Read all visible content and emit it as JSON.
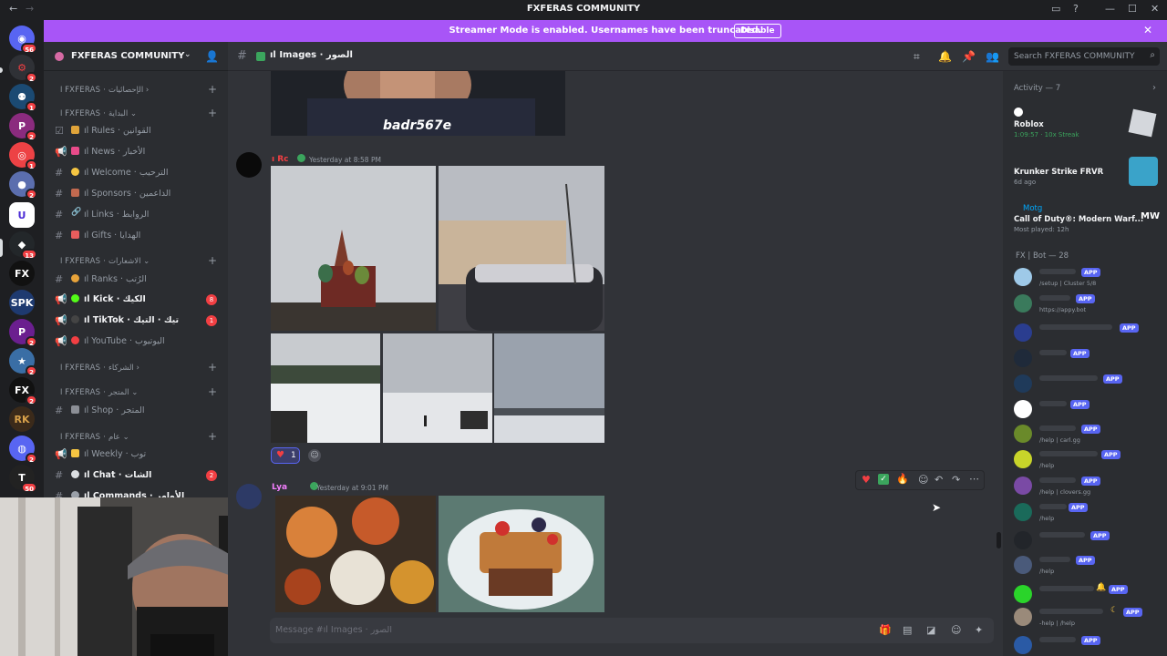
{
  "window": {
    "title": "FXFERAS COMMUNITY"
  },
  "banner": {
    "text": "Streamer Mode is enabled. Usernames have been truncated.",
    "button": "Disable"
  },
  "server": {
    "name": "FXFERAS COMMUNITY"
  },
  "rail": {
    "badges": [
      "56",
      "2",
      "1",
      "2",
      "1",
      "2",
      "13",
      "2",
      "2",
      "2",
      "2",
      "18",
      "50"
    ]
  },
  "sidebar": {
    "categories": [
      {
        "label": "ا FXFERAS · الإحصائيات ›"
      },
      {
        "label": "ا FXFERAS · البداية ⌄"
      },
      {
        "label": "ا FXFERAS · الاشعارات ⌄"
      },
      {
        "label": "ا FXFERAS · الشركاء ›"
      },
      {
        "label": "ا FXFERAS · المتجر ⌄"
      },
      {
        "label": "ا FXFERAS · عام ⌄"
      }
    ],
    "channels": [
      {
        "label": "ıl Rules · القوانين"
      },
      {
        "label": "ıl News · الأخبار"
      },
      {
        "label": "ıl Welcome · الترحيب"
      },
      {
        "label": "ıl Sponsors · الداعمين"
      },
      {
        "label": "ıl Links · الروابط"
      },
      {
        "label": "ıl Gifts · الهدايا"
      },
      {
        "label": "ıl Ranks · الرُتب"
      },
      {
        "label": "ıl Kick · الكيك",
        "badge": "8"
      },
      {
        "label": "ıl TikTok · تيك · التيك",
        "badge": "1"
      },
      {
        "label": "ıl YouTube · اليوتيوب"
      },
      {
        "label": "ıl Shop · المتجر"
      },
      {
        "label": "ıl Weekly · توب"
      },
      {
        "label": "ıl Chat · الشات",
        "badge": "2"
      },
      {
        "label": "ıl Commands · الأوامر"
      }
    ]
  },
  "header": {
    "channel": "ıl Images · الصور"
  },
  "search": {
    "placeholder": "Search FXFERAS COMMUNITY"
  },
  "chat": {
    "overlay_caption": "badr567e",
    "messages": [
      {
        "author": "ı Rc",
        "time": "Yesterday at 8:58 PM",
        "reaction_count": "1"
      },
      {
        "author": "Lya",
        "time": "Yesterday at 9:01 PM"
      }
    ],
    "composer_placeholder": "Message #ıl Images · الصور"
  },
  "members": {
    "activity_header": "Activity — 7",
    "activities": [
      {
        "name": "Roblox",
        "detail": "1:09:57 · 10x Streak"
      },
      {
        "name": "Krunker Strike FRVR",
        "detail": "6d ago"
      },
      {
        "user": "Motg",
        "name": "Call of Duty®: Modern Warf...",
        "detail": "Most played: 12h"
      }
    ],
    "bot_header": "FX | Bot — 28",
    "app_label": "APP",
    "bots": [
      {
        "status": "/setup | Cluster 5/8"
      },
      {
        "status": "https://appy.bot"
      },
      {
        "status": ""
      },
      {
        "status": ""
      },
      {
        "status": ""
      },
      {
        "status": ""
      },
      {
        "status": "/help | carl.gg"
      },
      {
        "status": "/help"
      },
      {
        "status": "/help | clovers.gg"
      },
      {
        "status": "/help"
      },
      {
        "status": ""
      },
      {
        "status": "/help"
      },
      {
        "status": ""
      },
      {
        "status": "-help | /help"
      },
      {
        "status": ""
      }
    ]
  },
  "colors": {
    "banner": "#a855f7",
    "accent": "#5865f2",
    "danger": "#f23f43"
  }
}
